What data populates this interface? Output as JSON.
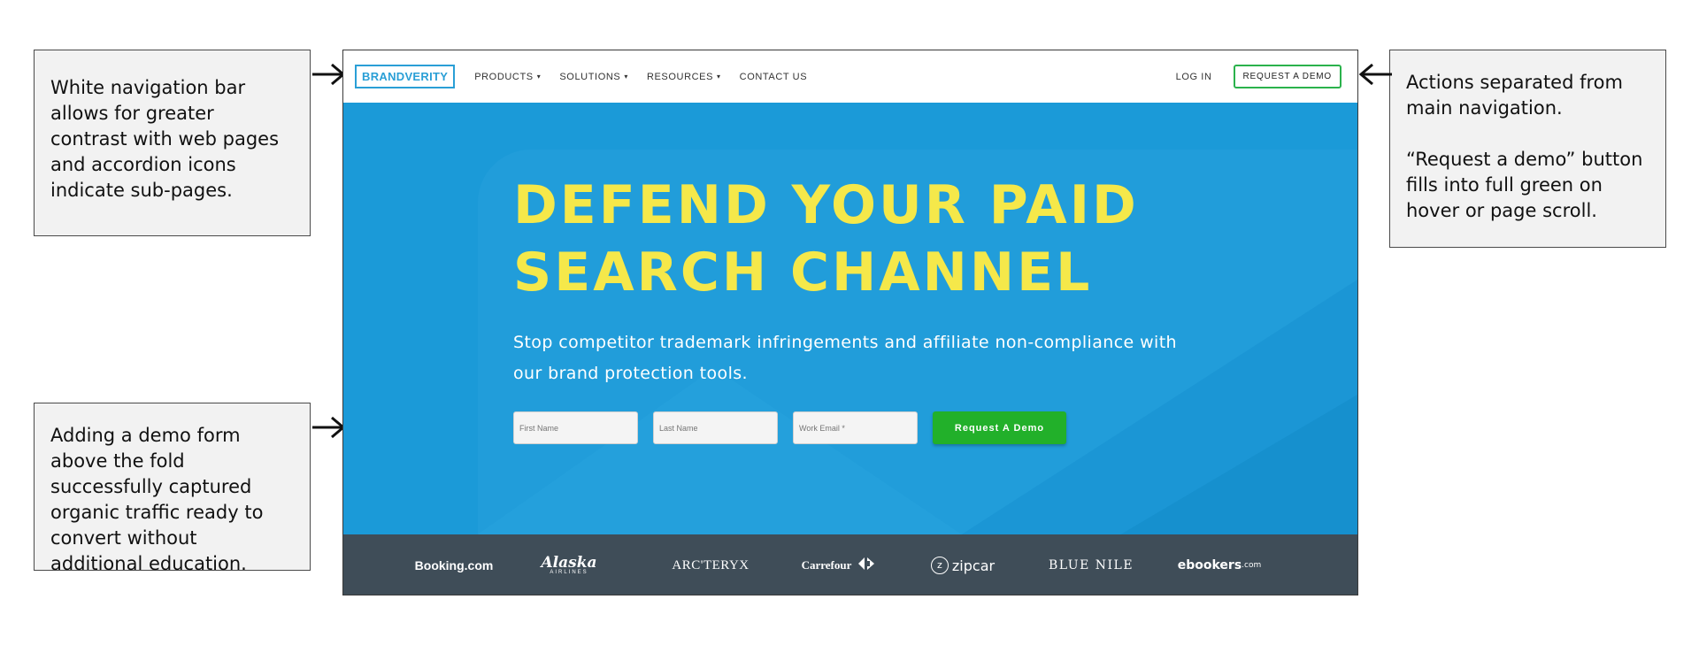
{
  "annotations": {
    "nav": "White navigation bar allows for greater contrast with web pages and accordion icons indicate sub-pages.",
    "actions": "Actions separated from main navigation.\n\n“Request a demo” button fills into full green on hover or page scroll.",
    "form": "Adding a demo form above the fold successfully captured organic traffic ready to convert without additional education."
  },
  "navbar": {
    "logo": "BRANDVERITY",
    "items": [
      {
        "label": "PRODUCTS",
        "has_caret": true
      },
      {
        "label": "SOLUTIONS",
        "has_caret": true
      },
      {
        "label": "RESOURCES",
        "has_caret": true
      },
      {
        "label": "CONTACT US",
        "has_caret": false
      }
    ],
    "caret_icon": "▾",
    "login": "LOG IN",
    "demo_button": "REQUEST A DEMO"
  },
  "hero": {
    "headline": "DEFEND YOUR PAID\nSEARCH CHANNEL",
    "subheadline": "Stop competitor trademark infringements and affiliate non-compliance with our brand protection tools.",
    "form": {
      "first_name_placeholder": "First Name",
      "last_name_placeholder": "Last Name",
      "email_placeholder": "Work Email *",
      "submit": "Request A Demo"
    }
  },
  "brands": {
    "booking": "Booking.com",
    "alaska": "Alaska",
    "alaska_sub": "AIRLINES",
    "arcteryx": "ARC'TERYX",
    "carrefour": "Carrefour",
    "zipcar_mark": "z",
    "zipcar": "zipcar",
    "bluenile": "BLUE NILE",
    "ebookers": "ebookers",
    "ebookers_suffix": ".com"
  },
  "colors": {
    "hero_blue": "#1b9ad8",
    "headline_yellow": "#f5e84a",
    "cta_green": "#22b02a",
    "nav_demo_border": "#2bb24c",
    "logo_strip": "#3f4d58",
    "logo_blue": "#2a9fd6"
  }
}
